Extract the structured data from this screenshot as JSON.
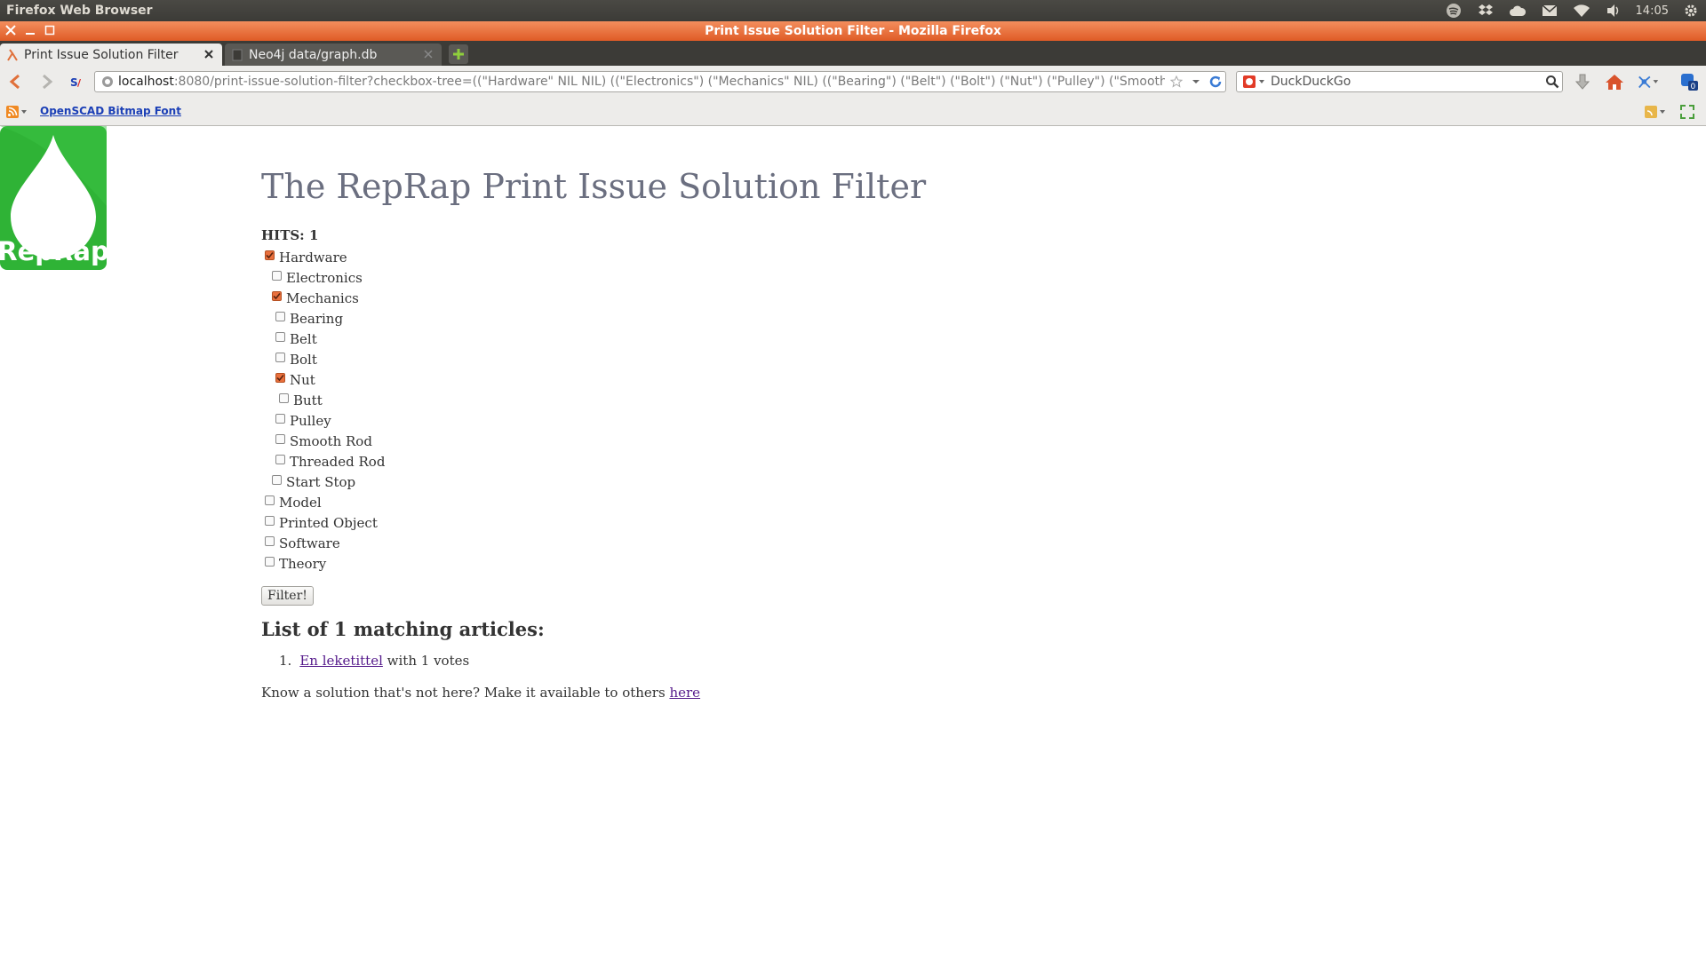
{
  "panel": {
    "app_name": "Firefox Web Browser",
    "clock": "14:05"
  },
  "window": {
    "title": "Print Issue Solution Filter - Mozilla Firefox"
  },
  "tabs": [
    {
      "label": "Print Issue Solution Filter"
    },
    {
      "label": "Neo4j data/graph.db"
    }
  ],
  "navbar": {
    "url_host": "localhost",
    "url_rest": ":8080/print-issue-solution-filter?checkbox-tree=((\"Hardware\" NIL NIL) ((\"Electronics\") (\"Mechanics\" NIL) ((\"Bearing\") (\"Belt\") (\"Bolt\") (\"Nut\") (\"Pulley\") (\"Smooth Rod\") (\"Th",
    "search_value": "DuckDuckGo",
    "downloads_badge": "0"
  },
  "bookmarks": {
    "items": [
      {
        "label": "OpenSCAD Bitmap Font"
      }
    ]
  },
  "page": {
    "logo_text": "RepRap",
    "title": "The RepRap Print Issue Solution Filter",
    "hits": "HITS: 1",
    "tree": [
      {
        "label": "Hardware",
        "checked": true,
        "level": 0
      },
      {
        "label": "Electronics",
        "checked": false,
        "level": 1
      },
      {
        "label": "Mechanics",
        "checked": true,
        "level": 1
      },
      {
        "label": "Bearing",
        "checked": false,
        "level": 2
      },
      {
        "label": "Belt",
        "checked": false,
        "level": 2
      },
      {
        "label": "Bolt",
        "checked": false,
        "level": 2
      },
      {
        "label": "Nut",
        "checked": true,
        "level": 2
      },
      {
        "label": "Butt",
        "checked": false,
        "level": 3
      },
      {
        "label": "Pulley",
        "checked": false,
        "level": 2
      },
      {
        "label": "Smooth Rod",
        "checked": false,
        "level": 2
      },
      {
        "label": "Threaded Rod",
        "checked": false,
        "level": 2
      },
      {
        "label": "Start Stop",
        "checked": false,
        "level": 1
      },
      {
        "label": "Model",
        "checked": false,
        "level": 0
      },
      {
        "label": "Printed Object",
        "checked": false,
        "level": 0
      },
      {
        "label": "Software",
        "checked": false,
        "level": 0
      },
      {
        "label": "Theory",
        "checked": false,
        "level": 0
      }
    ],
    "filter_button": "Filter!",
    "results_heading": "List of 1 matching articles:",
    "results": [
      {
        "number": "1.",
        "title": "En leketittel",
        "suffix": " with 1 votes"
      }
    ],
    "contribute_text": "Know a solution that's not here? Make it available to others ",
    "contribute_link": "here"
  },
  "colors": {
    "accent_orange": "#df5b26",
    "link": "#551a8b",
    "title_gray": "#6b6f80",
    "reprap_green": "#2fb336"
  }
}
